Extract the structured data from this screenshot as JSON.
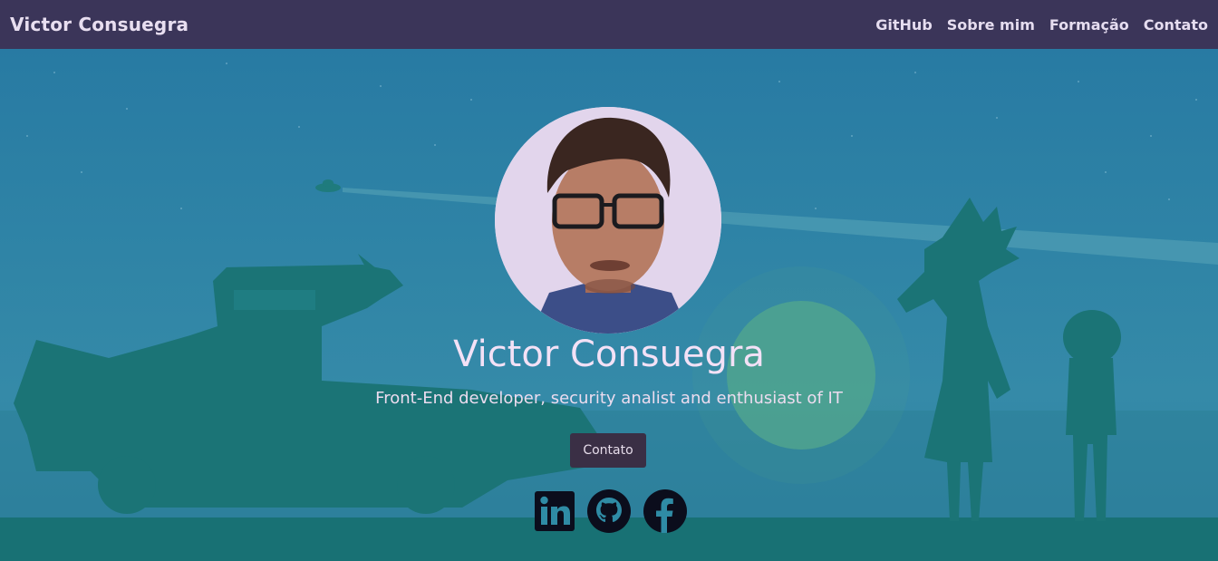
{
  "navbar": {
    "brand": "Victor Consuegra",
    "links": [
      {
        "label": "GitHub"
      },
      {
        "label": "Sobre mim"
      },
      {
        "label": "Formação"
      },
      {
        "label": "Contato"
      }
    ]
  },
  "hero": {
    "name": "Victor Consuegra",
    "tagline": "Front-End developer, security analist and enthusiast of IT",
    "contact_button": "Contato",
    "socials": [
      {
        "icon": "linkedin-icon"
      },
      {
        "icon": "github-icon"
      },
      {
        "icon": "facebook-icon"
      }
    ]
  },
  "colors": {
    "navbar_bg": "#3b3559",
    "sky": "#2a7c9e",
    "silhouette": "#1a7376",
    "button_bg": "#3a2f45"
  }
}
